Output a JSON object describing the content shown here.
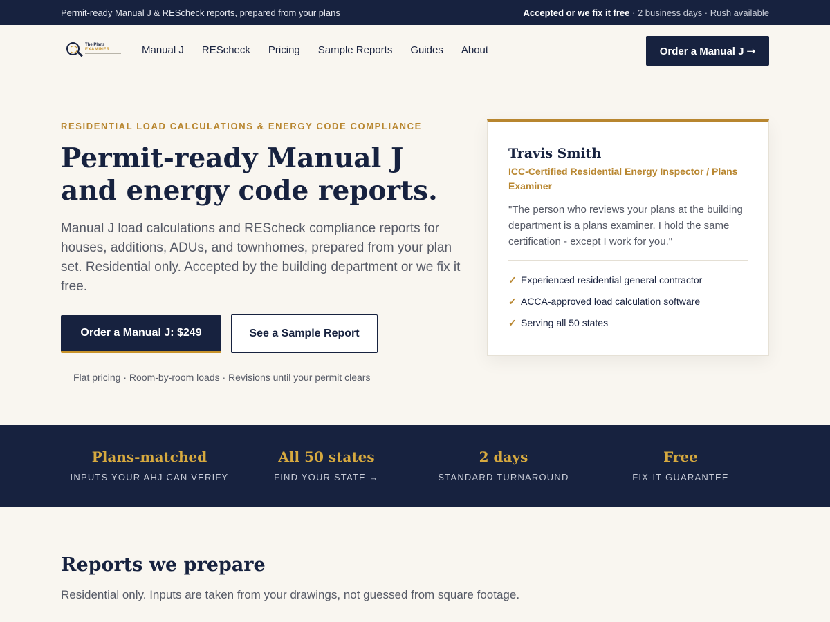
{
  "topbar": {
    "tagline": "Permit-ready Manual J & REScheck reports, prepared from your plans",
    "guarantee": "Accepted or we fix it free",
    "details": " · 2 business days · Rush available"
  },
  "header": {
    "logo": {
      "line1": "The Plans",
      "line2": "EXAMINER"
    },
    "nav": [
      "Manual J",
      "REScheck",
      "Pricing",
      "Sample Reports",
      "Guides",
      "About"
    ],
    "cta": "Order a Manual J ➝"
  },
  "hero": {
    "eyebrow": "RESIDENTIAL LOAD CALCULATIONS & ENERGY CODE COMPLIANCE",
    "title": "Permit-ready Manual J and energy code reports.",
    "description": "Manual J load calculations and REScheck compliance reports for houses, additions, ADUs, and townhomes, prepared from your plan set. Residential only. Accepted by the building department or we fix it free.",
    "primary_button": "Order a Manual J: $249",
    "secondary_button": "See a Sample Report",
    "note": "Flat pricing · Room-by-room loads · Revisions until your permit clears"
  },
  "card": {
    "name": "Travis Smith",
    "role": "ICC-Certified Residential Energy Inspector / Plans Examiner",
    "quote": "\"The person who reviews your plans at the building department is a plans examiner. I hold the same certification - except I work for you.\"",
    "checks": [
      "Experienced residential general contractor",
      "ACCA-approved load calculation software",
      "Serving all 50 states"
    ]
  },
  "stats": [
    {
      "value": "Plans-matched",
      "label": "INPUTS YOUR AHJ CAN VERIFY"
    },
    {
      "value": "All 50 states",
      "label": "FIND YOUR STATE →"
    },
    {
      "value": "2 days",
      "label": "STANDARD TURNAROUND"
    },
    {
      "value": "Free",
      "label": "FIX-IT GUARANTEE"
    }
  ],
  "section": {
    "title": "Reports we prepare",
    "subtitle": "Residential only. Inputs are taken from your drawings, not guessed from square footage."
  },
  "colors": {
    "navy": "#17223f",
    "gold": "#b8862f",
    "stat_gold": "#d6a93f",
    "background": "#f9f6f0"
  }
}
